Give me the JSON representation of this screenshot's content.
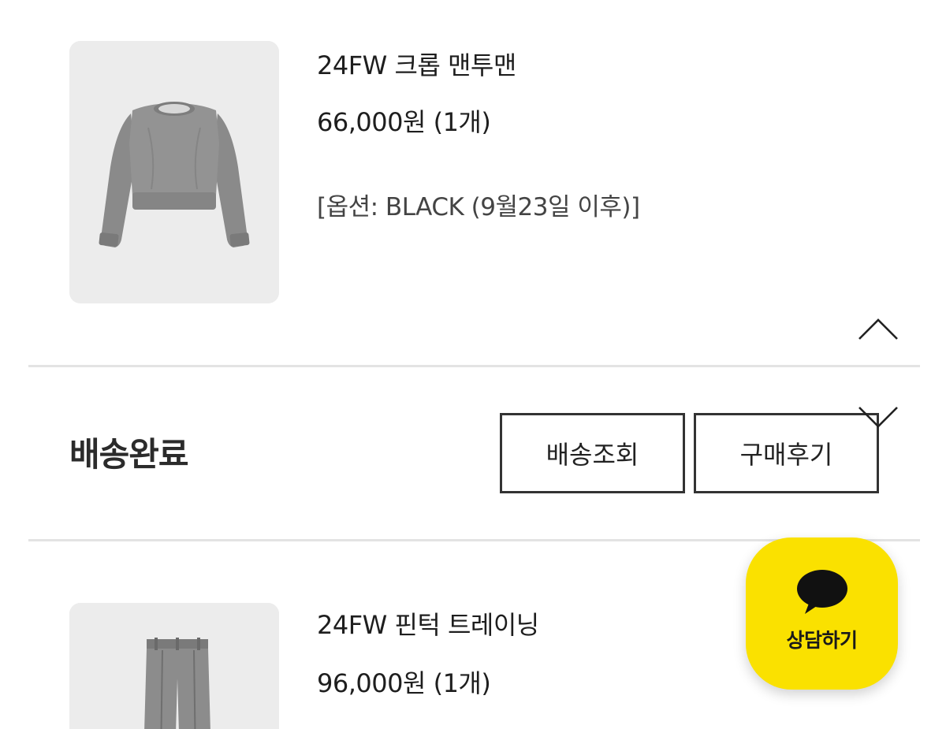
{
  "order_items": [
    {
      "name": "24FW 크롭 맨투맨",
      "price": "66,000원 (1개)",
      "option": "[옵션: BLACK (9월23일 이후)]",
      "image": "gray-cropped-sweatshirt"
    },
    {
      "name": "24FW 핀턱 트레이닝",
      "price": "96,000원 (1개)",
      "image": "gray-pintuck-pants"
    }
  ],
  "status_section": {
    "status": "배송완료",
    "track_label": "배송조회",
    "review_label": "구매후기"
  },
  "chat_button": {
    "label": "상담하기",
    "color": "#fae100",
    "icon": "speech-bubble-icon"
  },
  "icons": {
    "collapse": "chevron-up-icon",
    "expand": "chevron-down-icon"
  }
}
